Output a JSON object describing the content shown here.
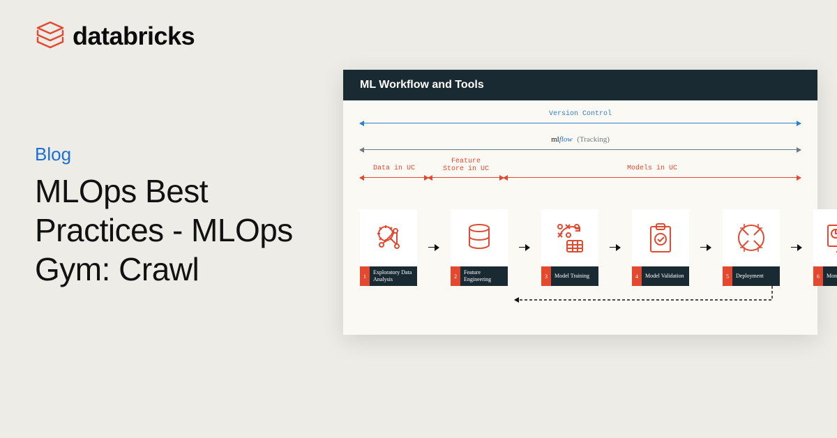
{
  "brand": "databricks",
  "category": "Blog",
  "headline": "MLOps Best Practices - MLOps Gym: Crawl",
  "panel": {
    "title": "ML Workflow and Tools",
    "spans": {
      "version_control": "Version Control",
      "mlflow_tracking": "(Tracking)",
      "data_in_uc": "Data in UC",
      "feature_store": "Feature\nStore in UC",
      "models_in_uc": "Models in UC"
    },
    "stages": [
      {
        "num": "1",
        "label": "Exploratory Data Analysis"
      },
      {
        "num": "2",
        "label": "Feature Engineering"
      },
      {
        "num": "3",
        "label": "Model Training"
      },
      {
        "num": "4",
        "label": "Model Validation"
      },
      {
        "num": "5",
        "label": "Deployment"
      },
      {
        "num": "6",
        "label": "Monitoring"
      }
    ]
  }
}
